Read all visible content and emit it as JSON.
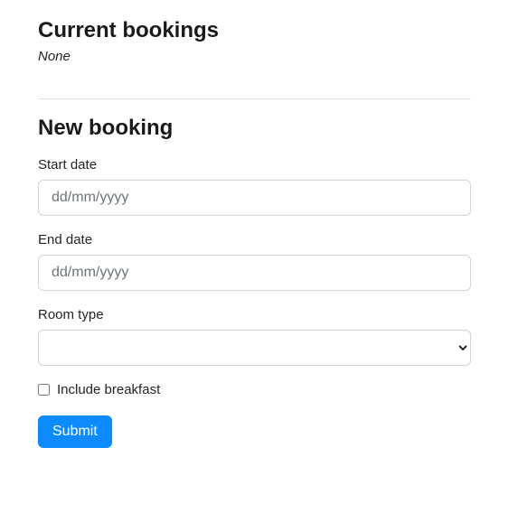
{
  "current_bookings": {
    "heading": "Current bookings",
    "empty_text": "None"
  },
  "new_booking": {
    "heading": "New booking",
    "start_date": {
      "label": "Start date",
      "placeholder": "dd/mm/yyyy",
      "value": ""
    },
    "end_date": {
      "label": "End date",
      "placeholder": "dd/mm/yyyy",
      "value": ""
    },
    "room_type": {
      "label": "Room type",
      "value": ""
    },
    "include_breakfast": {
      "label": "Include breakfast",
      "checked": false
    },
    "submit_label": "Submit"
  }
}
